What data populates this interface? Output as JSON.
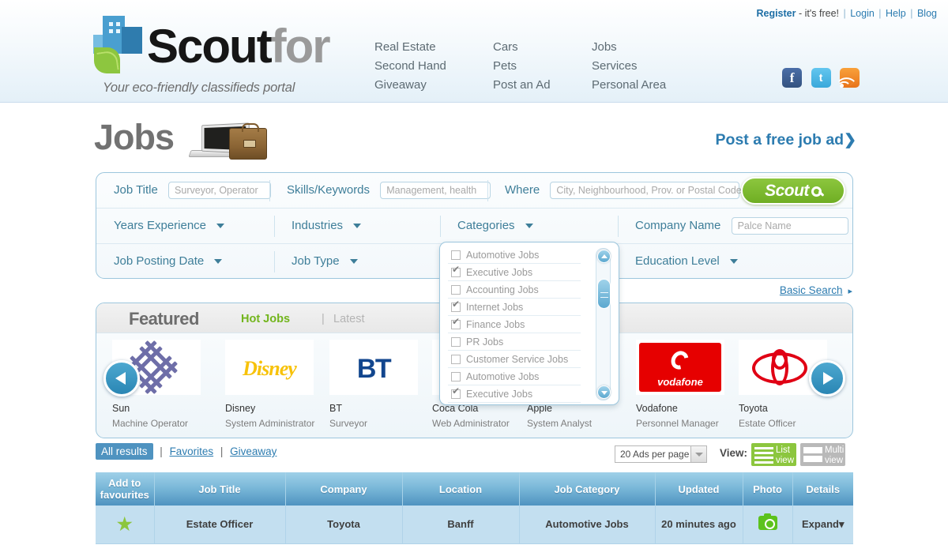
{
  "header": {
    "toplinks": {
      "register": "Register",
      "free": "- it's free!",
      "login": "Login",
      "help": "Help",
      "blog": "Blog",
      "sep": "|"
    },
    "logo": {
      "name_dark": "Scout",
      "name_gray": "for",
      "tagline": "Your eco-friendly classifieds portal"
    },
    "nav": [
      [
        "Real Estate",
        "Second Hand",
        "Giveaway"
      ],
      [
        "Cars",
        "Pets",
        "Post an Ad"
      ],
      [
        "Jobs",
        "Services",
        "Personal Area"
      ]
    ],
    "social": [
      {
        "name": "facebook-icon",
        "glyph": "f"
      },
      {
        "name": "twitter-icon",
        "glyph": "t"
      },
      {
        "name": "rss-icon",
        "glyph": ""
      }
    ]
  },
  "page": {
    "title": "Jobs",
    "post_ad": "Post a free job ad",
    "post_ad_chevron": "❯"
  },
  "search": {
    "job_title_label": "Job Title",
    "job_title_placeholder": "Surveyor, Operator",
    "skills_label": "Skills/Keywords",
    "skills_placeholder": "Management, health",
    "where_label": "Where",
    "where_placeholder": "City, Neighbourhood, Prov. or Postal Code",
    "scout_button": "Scout",
    "years_experience": "Years Experience",
    "industries": "Industries",
    "categories": "Categories",
    "company_name_label": "Company Name",
    "company_name_placeholder": "Palce Name",
    "job_posting_date": "Job Posting Date",
    "job_type": "Job Type",
    "education_level": "Education Level",
    "basic_search": "Basic Search",
    "basic_search_chevron": "▸"
  },
  "categories_dropdown": {
    "items": [
      {
        "label": "Automotive Jobs",
        "checked": false
      },
      {
        "label": "Executive Jobs",
        "checked": true
      },
      {
        "label": "Accounting Jobs",
        "checked": false
      },
      {
        "label": "Internet Jobs",
        "checked": true
      },
      {
        "label": "Finance Jobs",
        "checked": true
      },
      {
        "label": "PR Jobs",
        "checked": false
      },
      {
        "label": "Customer Service Jobs",
        "checked": false
      },
      {
        "label": "Automotive Jobs",
        "checked": false
      },
      {
        "label": "Executive Jobs",
        "checked": true
      }
    ]
  },
  "featured": {
    "title": "Featured",
    "tab_hot": "Hot Jobs",
    "tab_latest": "Latest",
    "separator": "|",
    "cards": [
      {
        "company": "Sun",
        "role": "Machine Operator",
        "logo": "sun-logo"
      },
      {
        "company": "Disney",
        "role": "System Administrator",
        "logo": "disney-logo"
      },
      {
        "company": "BT",
        "role": "Surveyor",
        "logo": "bt-logo"
      },
      {
        "company": "Coca Cola",
        "role": "Web Administrator",
        "logo": "coca-cola-logo"
      },
      {
        "company": "Apple",
        "role": "System Analyst",
        "logo": "apple-logo"
      },
      {
        "company": "Vodafone",
        "role": "Personnel Manager",
        "logo": "vodafone-logo"
      },
      {
        "company": "Toyota",
        "role": "Estate Officer",
        "logo": "toyota-logo"
      }
    ]
  },
  "results_bar": {
    "tab_all": "All results",
    "tab_favorites": "Favorites",
    "tab_giveaway": "Giveaway",
    "separator": "|",
    "per_page": "20 Ads per page",
    "view_label": "View:",
    "list_view_line1": "List",
    "list_view_line2": "view",
    "multi_view_line1": "Multi",
    "multi_view_line2": "view"
  },
  "table": {
    "headers": [
      "Add to favourites",
      "Job Title",
      "Company",
      "Location",
      "Job Category",
      "Updated",
      "Photo",
      "Details"
    ],
    "rows": [
      {
        "favourite": "★",
        "job_title": "Estate Officer",
        "company": "Toyota",
        "location": "Banff",
        "job_category": "Automotive Jobs",
        "updated": "20 minutes ago",
        "photo": "camera-icon",
        "details": "Expand",
        "details_caret": "▾"
      }
    ]
  },
  "colors": {
    "accent_blue": "#2d7cb0",
    "accent_green": "#8cc63e",
    "table_header": "#4f93c0",
    "row_bg": "#c3dff0"
  }
}
